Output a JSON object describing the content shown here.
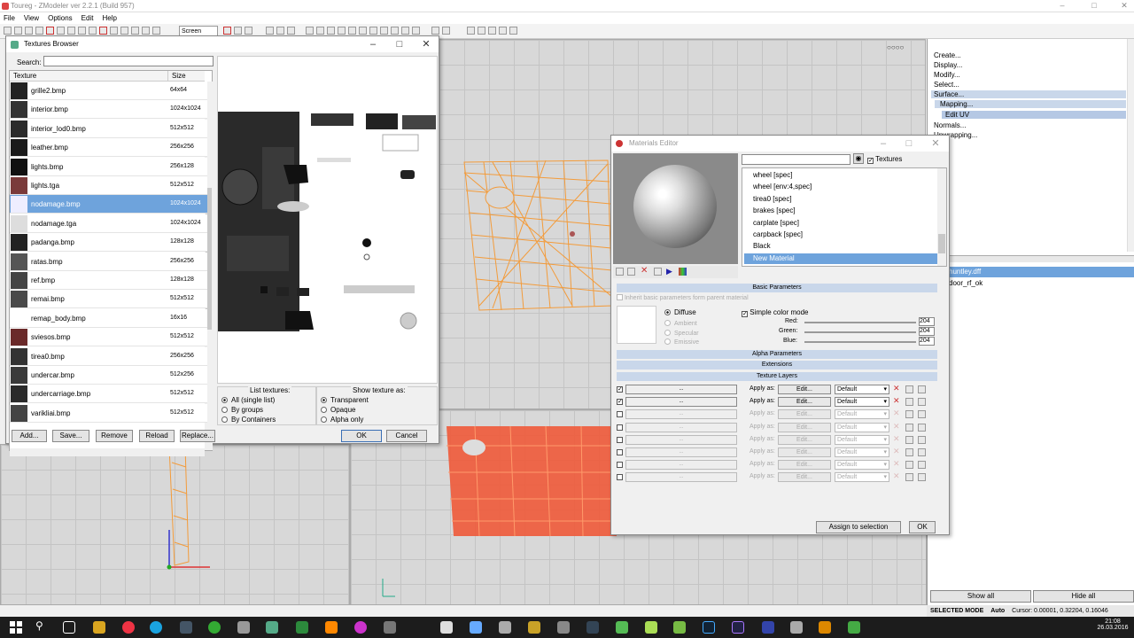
{
  "app": {
    "title": "Toureg - ZModeler ver 2.2.1 (Build 957)"
  },
  "menu": [
    "File",
    "View",
    "Options",
    "Edit",
    "Help"
  ],
  "toolbar": {
    "view_mode": "Screen"
  },
  "right_panel": {
    "commands": [
      "Create...",
      "Display...",
      "Modify...",
      "Select...",
      "Surface...",
      "Mapping...",
      "Edit UV",
      "Normals...",
      "Unwrapping..."
    ],
    "scene_items": [
      "huntley.dff",
      "door_rf_ok"
    ],
    "show_all": "Show all",
    "hide_all": "Hide all"
  },
  "status": {
    "mode": "SELECTED MODE",
    "auto": "Auto",
    "cursor": "Cursor: 0.00001, 0.32204, 0.16046"
  },
  "textures_browser": {
    "title": "Textures Browser",
    "search_label": "Search:",
    "search_value": "",
    "col_texture": "Texture",
    "col_size": "Size",
    "rows": [
      {
        "name": "grille2.bmp",
        "size": "64x64"
      },
      {
        "name": "interior.bmp",
        "size": "1024x1024"
      },
      {
        "name": "interior_lod0.bmp",
        "size": "512x512"
      },
      {
        "name": "leather.bmp",
        "size": "256x256"
      },
      {
        "name": "lights.bmp",
        "size": "256x128"
      },
      {
        "name": "lights.tga",
        "size": "512x512"
      },
      {
        "name": "nodamage.bmp",
        "size": "1024x1024"
      },
      {
        "name": "nodamage.tga",
        "size": "1024x1024"
      },
      {
        "name": "padanga.bmp",
        "size": "128x128"
      },
      {
        "name": "ratas.bmp",
        "size": "256x256"
      },
      {
        "name": "ref.bmp",
        "size": "128x128"
      },
      {
        "name": "remai.bmp",
        "size": "512x512"
      },
      {
        "name": "remap_body.bmp",
        "size": "16x16"
      },
      {
        "name": "sviesos.bmp",
        "size": "512x512"
      },
      {
        "name": "tirea0.bmp",
        "size": "256x256"
      },
      {
        "name": "undercar.bmp",
        "size": "512x256"
      },
      {
        "name": "undercarriage.bmp",
        "size": "512x512"
      },
      {
        "name": "varikliai.bmp",
        "size": "512x512"
      }
    ],
    "selected_row": "nodamage.bmp",
    "list_textures_label": "List textures:",
    "list_options": [
      "All (single list)",
      "By groups",
      "By Containers"
    ],
    "show_texture_label": "Show texture as:",
    "show_options": [
      "Transparent",
      "Opaque",
      "Alpha only"
    ],
    "buttons": {
      "add": "Add...",
      "save": "Save...",
      "remove": "Remove",
      "reload": "Reload",
      "replace": "Replace...",
      "ok": "OK",
      "cancel": "Cancel"
    }
  },
  "materials_editor": {
    "title": "Materials Editor",
    "textures_check": "Textures",
    "materials": [
      "wheel [spec]",
      "wheel [env:4,spec]",
      "tirea0 [spec]",
      "brakes [spec]",
      "carplate [spec]",
      "carpback [spec]",
      "Black",
      "New Material"
    ],
    "selected_material": "New Material",
    "basic_parameters": "Basic Parameters",
    "inherit_label": "Inherit basic parameters form parent material",
    "channels": [
      "Diffuse",
      "Ambient",
      "Specular",
      "Emissive"
    ],
    "simple_color_mode": "Simple color mode",
    "red_label": "Red:",
    "green_label": "Green:",
    "blue_label": "Blue:",
    "red": "204",
    "green": "204",
    "blue": "204",
    "alpha_parameters": "Alpha Parameters",
    "extensions": "Extensions",
    "texture_layers": "Texture Layers",
    "apply_as": "Apply as:",
    "edit_label": "Edit...",
    "default_label": "Default",
    "layer_slot": "...",
    "assign_button": "Assign to selection",
    "ok_button": "OK"
  },
  "taskbar": {
    "time": "21:08",
    "date": "26.03.2016"
  },
  "colors": {
    "selection": "#6ea3dc",
    "wire": "#f39b3a",
    "red_mesh": "#f05a3a",
    "section": "#c9d7ea"
  }
}
